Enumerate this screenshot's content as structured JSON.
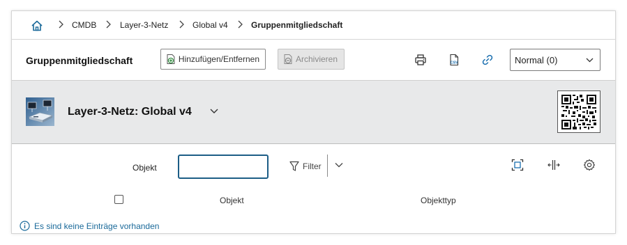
{
  "breadcrumb": {
    "home_icon": "home-icon",
    "items": [
      "CMDB",
      "Layer-3-Netz",
      "Global v4",
      "Gruppenmitgliedschaft"
    ]
  },
  "toolbar": {
    "title": "Gruppenmitgliedschaft",
    "add_remove_label": "Hinzufügen/Entfernen",
    "archive_label": "Archivieren",
    "icons": [
      "printer-icon",
      "csv-export-icon",
      "link-icon"
    ],
    "view_select": {
      "value": "Normal (0)"
    }
  },
  "object": {
    "title": "Layer-3-Netz: Global v4",
    "image_icon": "network-devices-image",
    "qr_icon": "qr-code"
  },
  "filter": {
    "label": "Objekt",
    "input_value": "",
    "filter_label": "Filter",
    "icons": [
      "fit-screen-icon",
      "column-resize-icon",
      "settings-gear-icon"
    ]
  },
  "table": {
    "columns": [
      "Objekt",
      "Objekttyp"
    ],
    "rows": [],
    "empty_message": "Es sind keine Einträge vorhanden"
  },
  "colors": {
    "accent": "#1c5d86",
    "info_text": "#1b6a9a",
    "header_bg": "#e8e9ea",
    "link_icon": "#1a6fb0"
  }
}
